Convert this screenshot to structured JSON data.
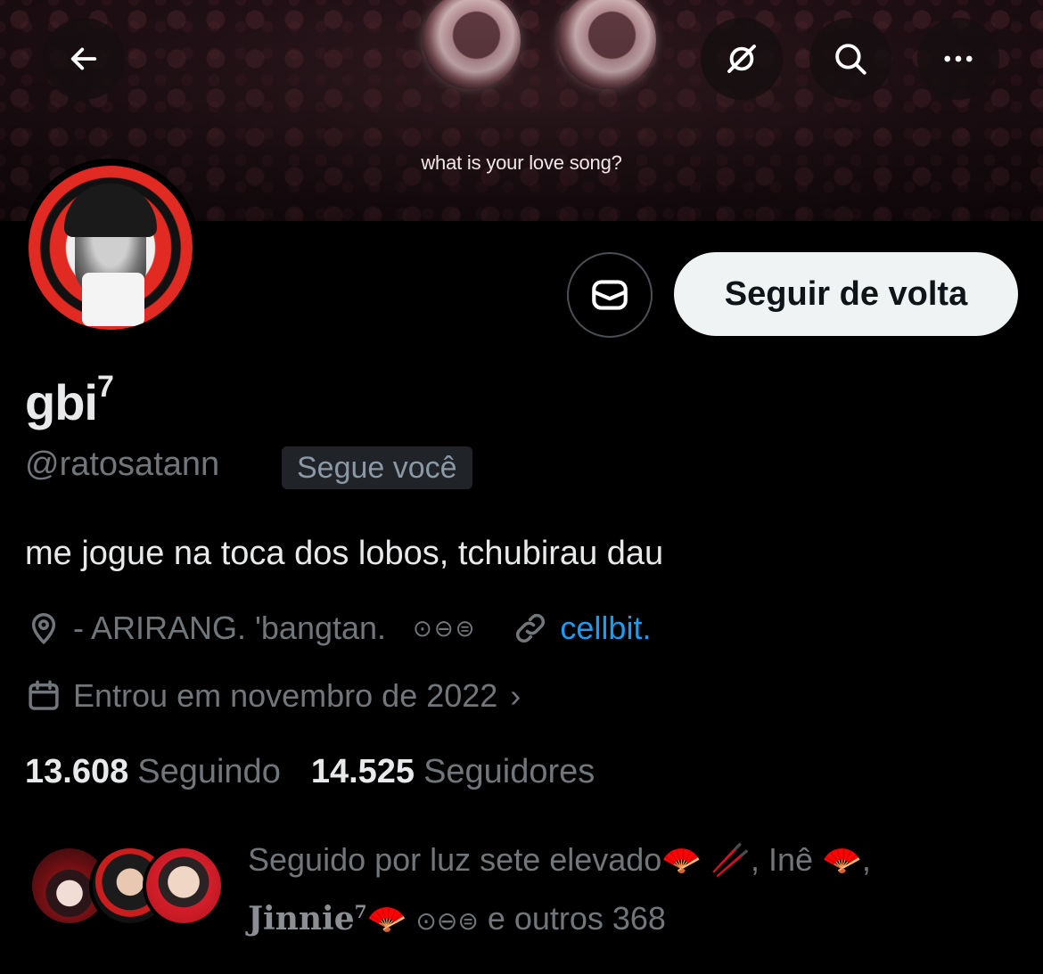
{
  "banner": {
    "caption": "what is your love song?"
  },
  "header": {
    "back_icon": "arrow-left-icon",
    "notifications_off_icon": "notifications-off-icon",
    "search_icon": "search-icon",
    "more_icon": "more-icon"
  },
  "actions": {
    "message_icon": "envelope-icon",
    "follow_back_label": "Seguir de volta"
  },
  "profile": {
    "display_name": "gbi",
    "display_name_sup": "7",
    "handle": "@ratosatann",
    "follows_you_badge": "Segue você",
    "bio": "me jogue na toca dos lobos, tchubirau dau",
    "location": "- ARIRANG. 'bangtan.",
    "location_symbols": "⊙⊖⊜",
    "link": "cellbit.",
    "joined": "Entrou em novembro de 2022"
  },
  "stats": {
    "following_count": "13.608",
    "following_label": "Seguindo",
    "followers_count": "14.525",
    "followers_label": "Seguidores"
  },
  "followed_by": {
    "prefix": "Seguido por luz sete elevado",
    "emoji_1": "🪭",
    "emoji_2": "🥢",
    "sep_1": ", Inê",
    "emoji_3": "🪭",
    "sep_2": ",",
    "name_3": "Jinnie",
    "name_3_sup": "7",
    "emoji_4": "🪭",
    "symbols": "⊙⊖⊜",
    "suffix": "e outros 368"
  },
  "colors": {
    "background": "#000000",
    "text_primary": "#e7e9ea",
    "text_secondary": "#71767b",
    "link": "#1d9bf0",
    "follow_button_bg": "#eff3f4"
  }
}
